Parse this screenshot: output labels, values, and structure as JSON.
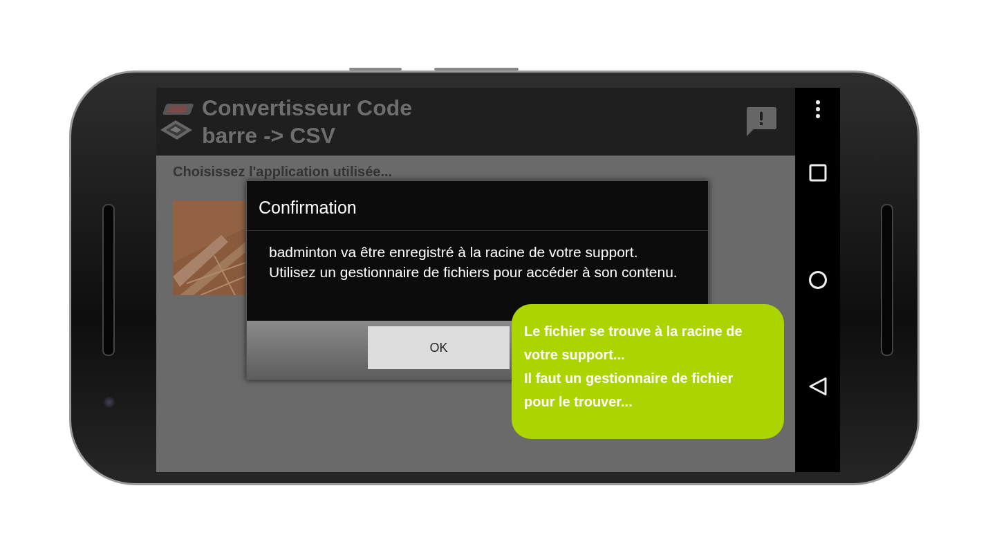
{
  "app_bar": {
    "title": "Convertisseur Code barre -> CSV"
  },
  "content": {
    "prompt": "Choisissez l'application utilisée..."
  },
  "dialog": {
    "title": "Confirmation",
    "message": "badminton va être enregistré à la racine de votre support. Utilisez un gestionnaire de fichiers pour accéder à son contenu.",
    "buttons": [
      "OK"
    ]
  },
  "callout": {
    "paragraphs": [
      "Le fichier se trouve à la racine de votre support...",
      "Il faut un gestionnaire de fichier pour le trouver..."
    ]
  }
}
